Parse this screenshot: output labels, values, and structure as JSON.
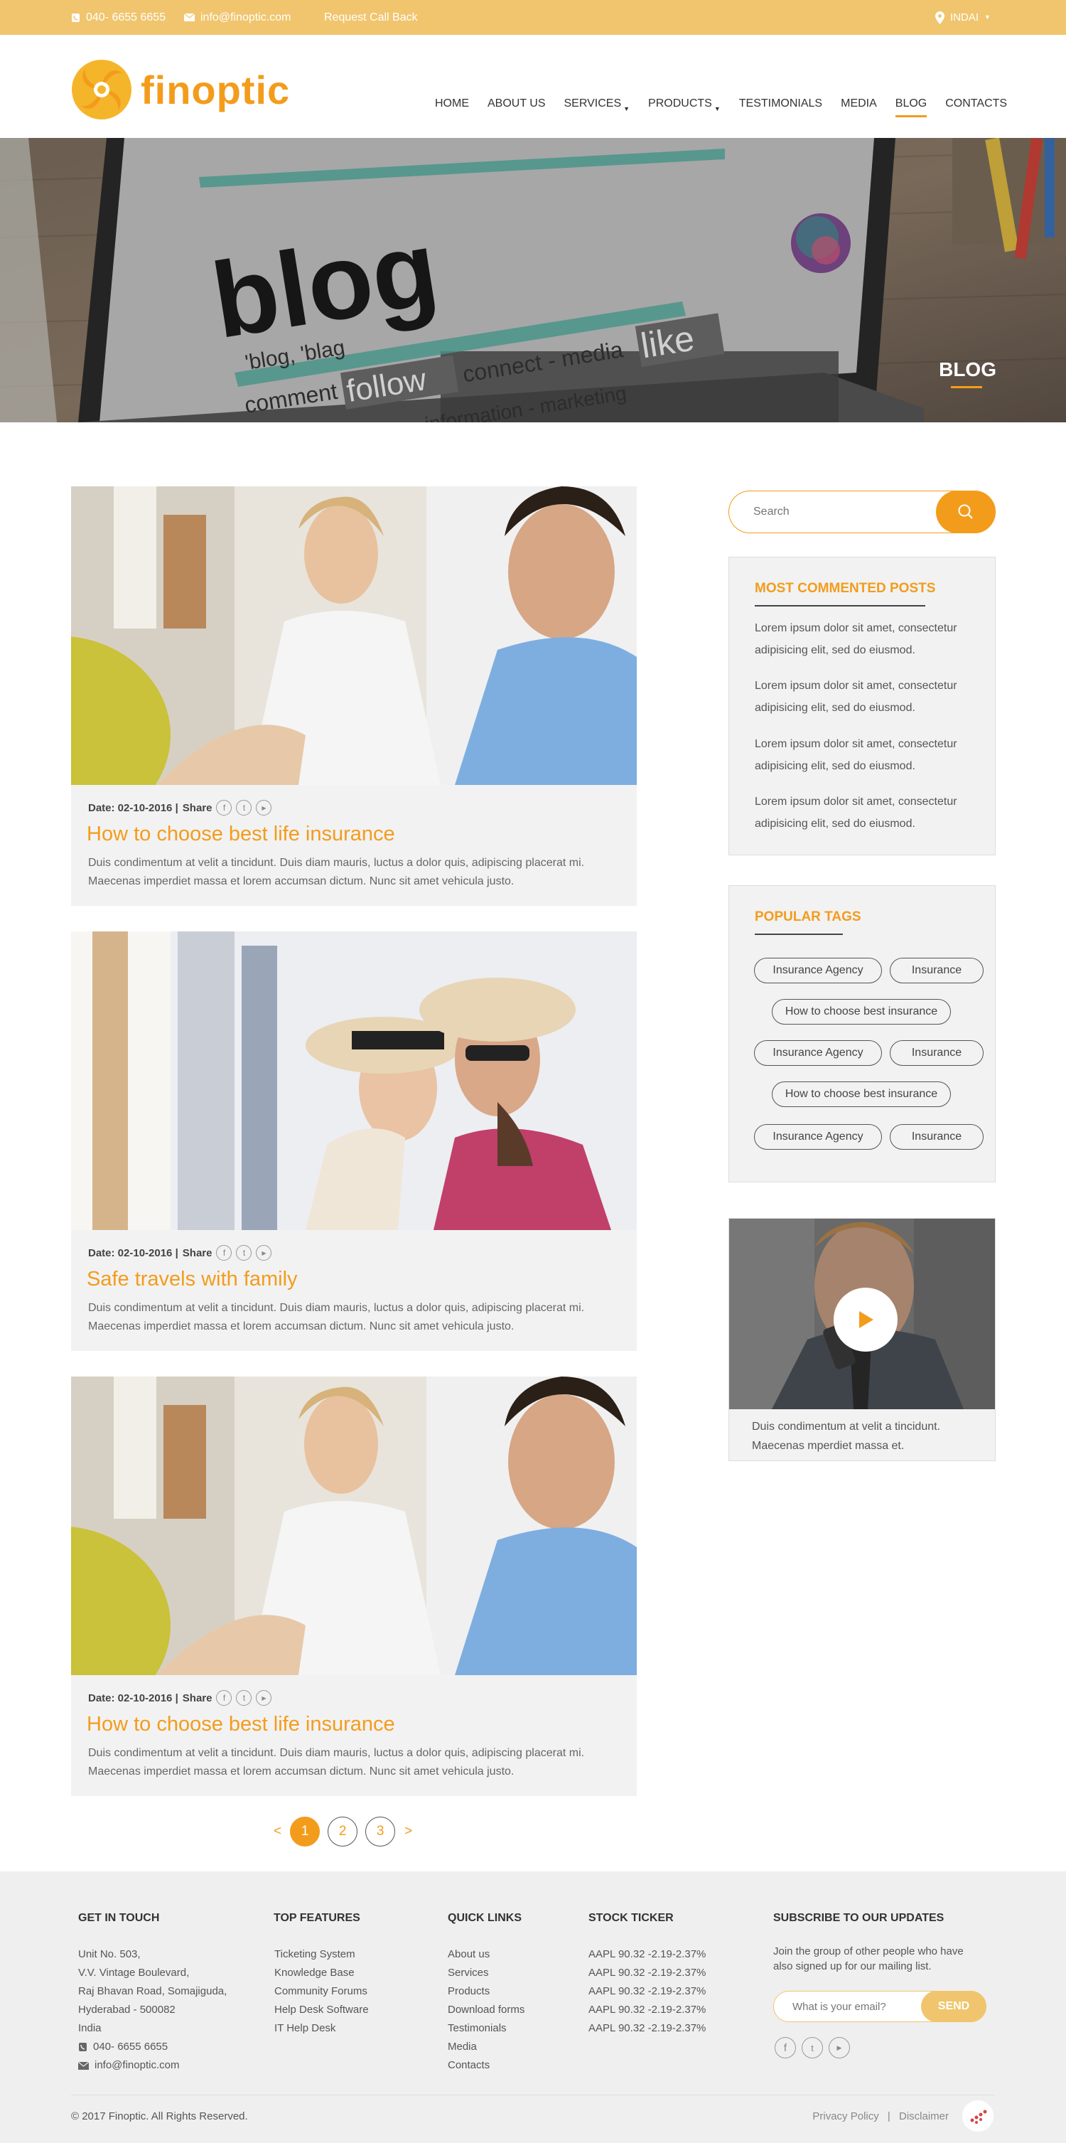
{
  "topbar": {
    "phone": "040- 6655 6655",
    "email": "info@finoptic.com",
    "callback": "Request Call Back",
    "country": "INDAI"
  },
  "brand": {
    "name": "finoptic",
    "accent": "#f39c1c",
    "topbar_color": "#f0c56e"
  },
  "nav": [
    {
      "label": "HOME",
      "active": false,
      "dropdown": false
    },
    {
      "label": "ABOUT US",
      "active": false,
      "dropdown": false
    },
    {
      "label": "SERVICES",
      "active": false,
      "dropdown": true
    },
    {
      "label": "PRODUCTS",
      "active": false,
      "dropdown": true
    },
    {
      "label": "TESTIMONIALS",
      "active": false,
      "dropdown": false
    },
    {
      "label": "MEDIA",
      "active": false,
      "dropdown": false
    },
    {
      "label": "BLOG",
      "active": true,
      "dropdown": false
    },
    {
      "label": "CONTACTS",
      "active": false,
      "dropdown": false
    }
  ],
  "hero": {
    "title": "BLOG",
    "screen_words": [
      "blog",
      "'blog, 'blag",
      "comment",
      "follow",
      "connect - media",
      "like",
      "networking - new - information - marketing"
    ]
  },
  "posts": [
    {
      "date": "Date: 02-10-2016 |",
      "share": "Share",
      "title": "How to choose best life insurance",
      "desc_line1": "Duis condimentum at velit a tincidunt. Duis diam mauris, luctus a dolor quis, adipiscing placerat mi.",
      "desc_line2": "Maecenas  imperdiet  massa et  lorem  accumsan  dictum. Nunc  sit  amet  vehicula  justo."
    },
    {
      "date": "Date: 02-10-2016 |",
      "share": "Share",
      "title": "Safe travels with family",
      "desc_line1": "Duis condimentum at velit a tincidunt. Duis diam mauris, luctus a dolor quis, adipiscing placerat mi.",
      "desc_line2": "Maecenas  imperdiet  massa et  lorem  accumsan  dictum. Nunc  sit  amet  vehicula  justo."
    },
    {
      "date": "Date: 02-10-2016 |",
      "share": "Share",
      "title": "How to choose best life insurance",
      "desc_line1": "Duis condimentum at velit a tincidunt. Duis diam mauris, luctus a dolor quis, adipiscing placerat mi.",
      "desc_line2": "Maecenas  imperdiet  massa et  lorem  accumsan  dictum. Nunc  sit  amet  vehicula  justo."
    }
  ],
  "sidebar": {
    "search_placeholder": "Search",
    "most_commented_title": "MOST COMMENTED POSTS",
    "most_commented": [
      {
        "l1": "Lorem ipsum dolor sit amet, consectetur",
        "l2": "adipisicing elit,  sed do  eiusmod."
      },
      {
        "l1": "Lorem ipsum dolor sit amet, consectetur",
        "l2": "adipisicing elit,  sed do  eiusmod."
      },
      {
        "l1": "Lorem ipsum dolor sit amet, consectetur",
        "l2": "adipisicing elit,  sed do  eiusmod."
      },
      {
        "l1": "Lorem ipsum dolor sit amet, consectetur",
        "l2": "adipisicing elit,  sed do  eiusmod."
      }
    ],
    "popular_tags_title": "POPULAR TAGS",
    "tags": [
      "Insurance Agency",
      "Insurance",
      "How to choose best insurance",
      "Insurance Agency",
      "Insurance",
      "How to choose best insurance",
      "Insurance Agency",
      "Insurance"
    ],
    "video_text_l1": "Duis condimentum at velit a tincidunt.",
    "video_text_l2": "Maecenas mperdiet massa et."
  },
  "pagination": {
    "prev": "<",
    "pages": [
      "1",
      "2",
      "3"
    ],
    "current": "1",
    "next": ">"
  },
  "footer": {
    "get_in_touch": {
      "title": "GET IN TOUCH",
      "lines": [
        "Unit No. 503,",
        "V.V. Vintage Boulevard,",
        "Raj Bhavan Road, Somajiguda,",
        "Hyderabad - 500082",
        "India"
      ],
      "phone": "040- 6655 6655",
      "email": "info@finoptic.com"
    },
    "top_features": {
      "title": "TOP FEATURES",
      "items": [
        "Ticketing System",
        "Knowledge Base",
        "Community Forums",
        "Help Desk Software",
        "IT Help Desk"
      ]
    },
    "quick_links": {
      "title": "QUICK LINKS",
      "items": [
        "About us",
        "Services",
        "Products",
        "Download forms",
        "Testimonials",
        "Media",
        "Contacts"
      ]
    },
    "stock_ticker": {
      "title": "STOCK TICKER",
      "items": [
        "AAPL 90.32 -2.19-2.37%",
        "AAPL 90.32 -2.19-2.37%",
        "AAPL 90.32 -2.19-2.37%",
        "AAPL 90.32 -2.19-2.37%",
        "AAPL 90.32 -2.19-2.37%"
      ]
    },
    "subscribe": {
      "title": "SUBSCRIBE TO OUR UPDATES",
      "text_l1": "Join the group of other people who have",
      "text_l2": "also signed up for our mailing list.",
      "placeholder": "What is your email?",
      "button": "SEND"
    },
    "copyright": "© 2017 Finoptic. All Rights Reserved.",
    "privacy": "Privacy Policy",
    "sep": "|",
    "disclaimer": "Disclaimer"
  }
}
